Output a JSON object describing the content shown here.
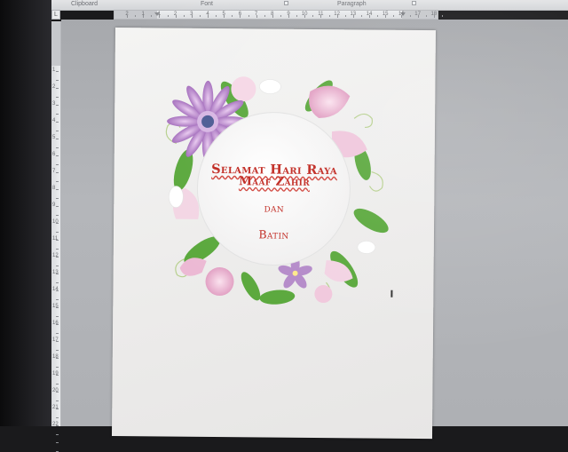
{
  "ribbon": {
    "groups": [
      {
        "label": "Clipboard",
        "offset": 80
      },
      {
        "label": "Font",
        "offset": 226
      },
      {
        "label": "Paragraph",
        "offset": 380
      }
    ]
  },
  "ruler": {
    "tab_selector": "L",
    "horizontal_numbers": [
      "2",
      "1",
      "1",
      "2",
      "3",
      "4",
      "5",
      "6",
      "7",
      "8",
      "9",
      "10",
      "11",
      "12",
      "13",
      "14",
      "15",
      "16",
      "17",
      "18"
    ],
    "vertical_numbers": [
      "1",
      "2",
      "3",
      "4",
      "5",
      "6",
      "7",
      "8",
      "9",
      "10",
      "11",
      "12",
      "13",
      "14",
      "15",
      "16",
      "17",
      "18",
      "19",
      "20",
      "21",
      "22"
    ]
  },
  "document": {
    "greeting_lines": [
      "Selamat Hari Raya",
      "Maaf Zahir",
      "dan",
      "Batin"
    ]
  },
  "colors": {
    "greeting_text": "#c0271f",
    "petal_pink": "#e9a6c8",
    "petal_purple": "#b980c9",
    "leaf_green": "#5aa83c",
    "center_blue": "#4b5a93"
  }
}
